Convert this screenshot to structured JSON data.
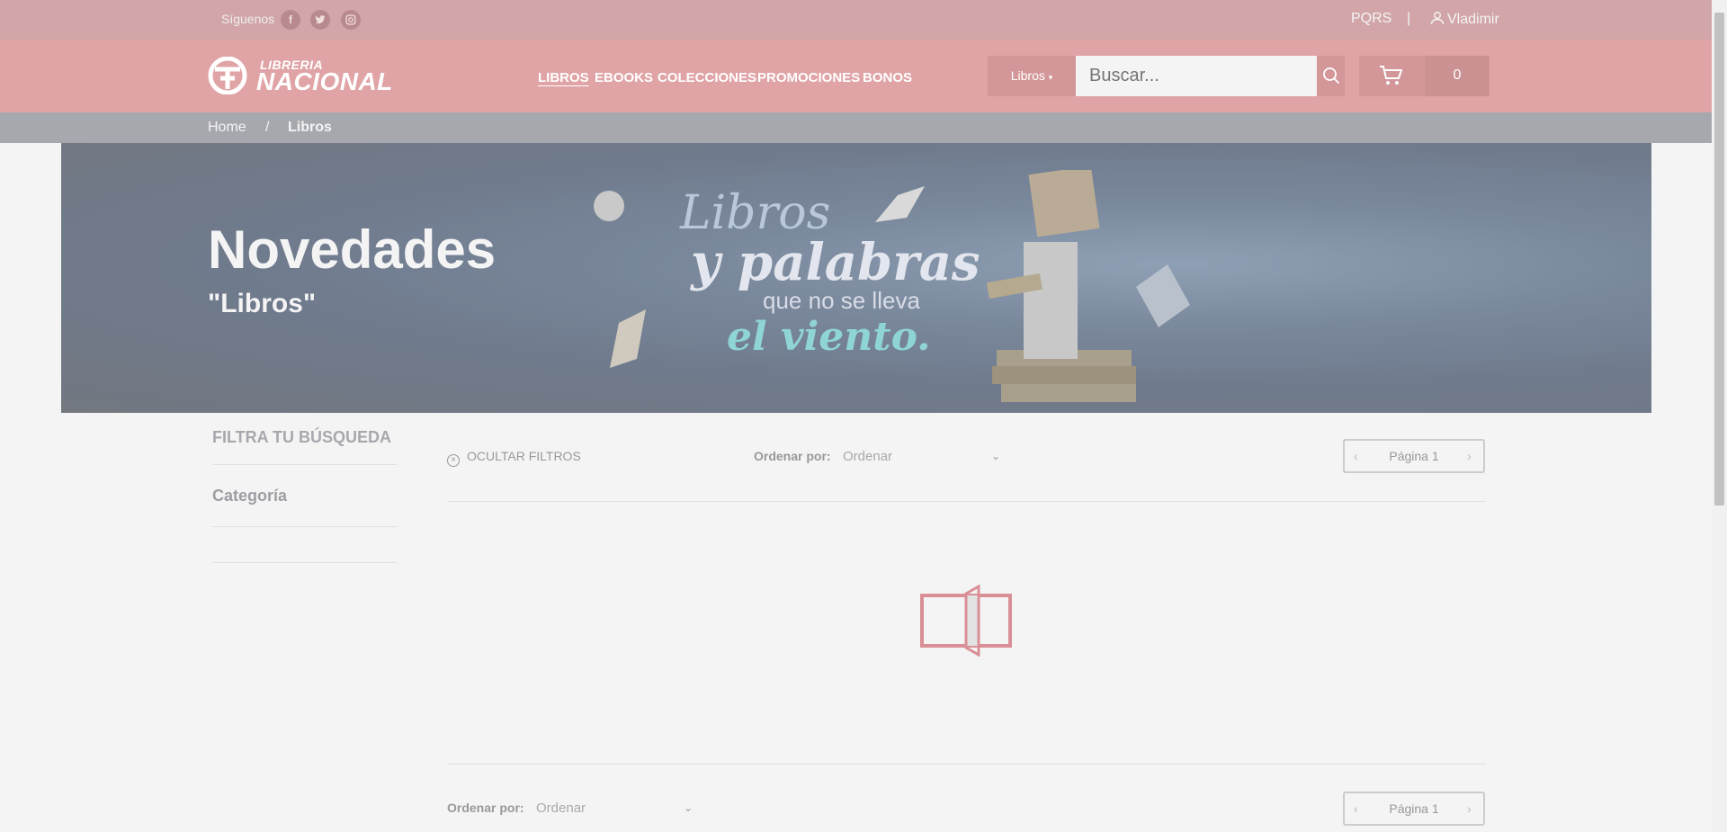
{
  "topbar": {
    "follow_label": "Síguenos",
    "social": [
      "f",
      "t",
      "ig"
    ],
    "pqrs": "PQRS",
    "separator": "|",
    "user": "Vladimir"
  },
  "header": {
    "logo_top": "LIBRERIA",
    "logo_bottom": "NACIONAL",
    "nav": [
      "LIBROS",
      "EBOOKS",
      "COLECCIONES",
      "PROMOCIONES",
      "BONOS"
    ],
    "category_select": "Libros",
    "search_placeholder": "Buscar...",
    "cart_count": "0"
  },
  "breadcrumb": {
    "home": "Home",
    "separator": "/",
    "current": "Libros"
  },
  "banner": {
    "title": "Novedades",
    "subtitle": "\"Libros\"",
    "line1": "Libros",
    "line2": "y palabras",
    "line3": "que no se lleva",
    "line4": "el viento."
  },
  "filters": {
    "title": "FILTRA TU BÚSQUEDA",
    "category": "Categoría",
    "hide": "OCULTAR FILTROS"
  },
  "sort": {
    "label": "Ordenar por:",
    "value": "Ordenar"
  },
  "pager": {
    "label": "Página 1"
  }
}
